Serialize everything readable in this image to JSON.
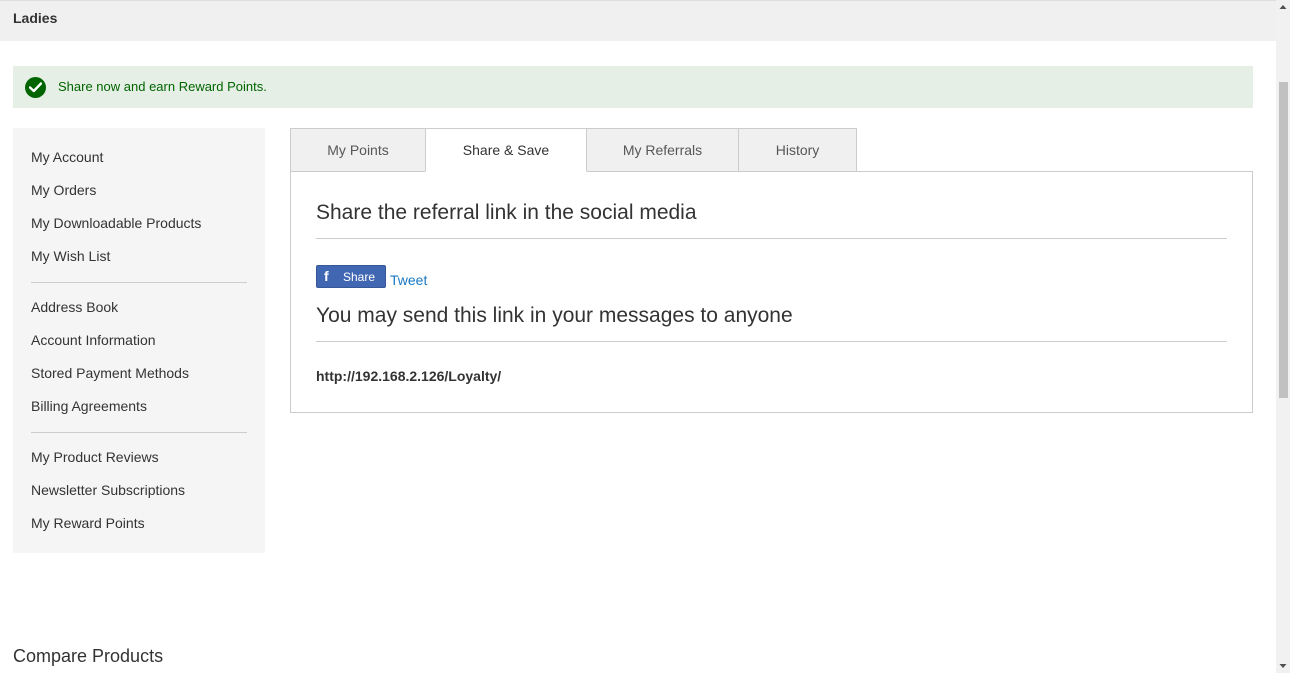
{
  "topbar": {
    "title": "Ladies"
  },
  "alert": {
    "message": "Share now and earn Reward Points.",
    "icon": "check-circle-icon",
    "color": "#006400",
    "background": "#e5efe5"
  },
  "sidebar": {
    "items": [
      {
        "label": "My Account"
      },
      {
        "label": "My Orders"
      },
      {
        "label": "My Downloadable Products"
      },
      {
        "label": "My Wish List"
      },
      {
        "label": "Address Book"
      },
      {
        "label": "Account Information"
      },
      {
        "label": "Stored Payment Methods"
      },
      {
        "label": "Billing Agreements"
      },
      {
        "label": "My Product Reviews"
      },
      {
        "label": "Newsletter Subscriptions"
      },
      {
        "label": "My Reward Points"
      }
    ]
  },
  "tabs": [
    {
      "label": "My Points"
    },
    {
      "label": "Share & Save",
      "active": true
    },
    {
      "label": "My Referrals"
    },
    {
      "label": "History"
    }
  ],
  "panel": {
    "heading_social": "Share the referral link in the social media",
    "facebook_share_label": "Share",
    "facebook_icon": "facebook-f-icon",
    "tweet_label": "Tweet",
    "heading_message": "You may send this link in your messages to anyone",
    "referral_link": "http://192.168.2.126/Loyalty/"
  },
  "compare": {
    "title": "Compare Products"
  },
  "colors": {
    "link": "#1979c3",
    "facebook": "#4267b2",
    "success_text": "#006400"
  }
}
